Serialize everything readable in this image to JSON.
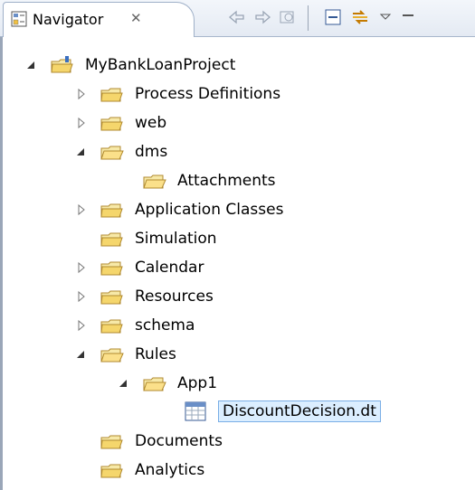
{
  "view": {
    "title": "Navigator",
    "close_label": "✕"
  },
  "toolbar": {
    "buttons": [
      "back",
      "forward",
      "refresh",
      "collapse-all",
      "link-with-editor",
      "view-menu",
      "minimize"
    ]
  },
  "tree": {
    "project": "MyBankLoanProject",
    "items": [
      {
        "label": "Process Definitions",
        "state": "collapsed"
      },
      {
        "label": "web",
        "state": "collapsed"
      },
      {
        "label": "dms",
        "state": "expanded"
      },
      {
        "label": "Attachments",
        "state": "leaf"
      },
      {
        "label": "Application Classes",
        "state": "collapsed"
      },
      {
        "label": "Simulation",
        "state": "leaf"
      },
      {
        "label": "Calendar",
        "state": "collapsed"
      },
      {
        "label": "Resources",
        "state": "collapsed"
      },
      {
        "label": "schema",
        "state": "collapsed"
      },
      {
        "label": "Rules",
        "state": "expanded"
      },
      {
        "label": "App1",
        "state": "expanded"
      },
      {
        "label": "DiscountDecision.dt",
        "state": "selected-file"
      },
      {
        "label": "Documents",
        "state": "leaf"
      },
      {
        "label": "Analytics",
        "state": "leaf"
      }
    ]
  }
}
